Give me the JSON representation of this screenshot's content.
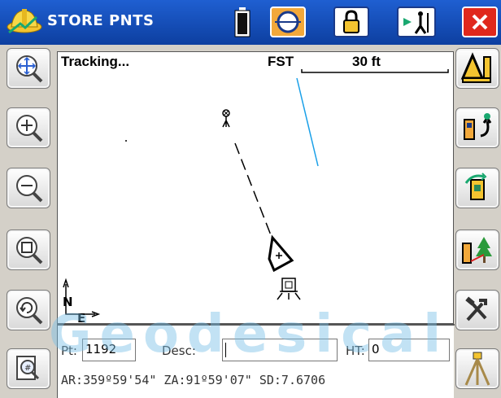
{
  "titlebar": {
    "title": "STORE PNTS",
    "icons": [
      "hardhat-logo-icon",
      "battery-icon",
      "measure-target-icon",
      "lock-icon",
      "station-setup-icon",
      "close-icon"
    ]
  },
  "map": {
    "tracking_label": "Tracking...",
    "mode_label": "FST",
    "scale_label": "30 ft",
    "north_label": "N",
    "east_label": "E"
  },
  "left_toolbar": {
    "icons": [
      "zoom-extents-icon",
      "zoom-in-icon",
      "zoom-out-icon",
      "zoom-window-icon",
      "zoom-previous-icon",
      "zoom-point-icon"
    ]
  },
  "right_toolbar": {
    "icons": [
      "cogo-icon",
      "rod-swap-icon",
      "instrument-rotate-icon",
      "stakeout-icon",
      "tools-icon",
      "tripod-icon"
    ]
  },
  "form": {
    "pt_label": "Pt:",
    "pt_value": "1192",
    "desc_label": "Desc:",
    "desc_value": "",
    "ht_label": "HT:",
    "ht_value": "0"
  },
  "status": "AR:359º59'54\" ZA:91º59'07\"  SD:7.6706",
  "watermark": "Geodesical",
  "colors": {
    "titlebar": "#1f5fd1",
    "close": "#e0281c",
    "accent_orange": "#f2a83a",
    "line_blue": "#1aa0e8"
  }
}
